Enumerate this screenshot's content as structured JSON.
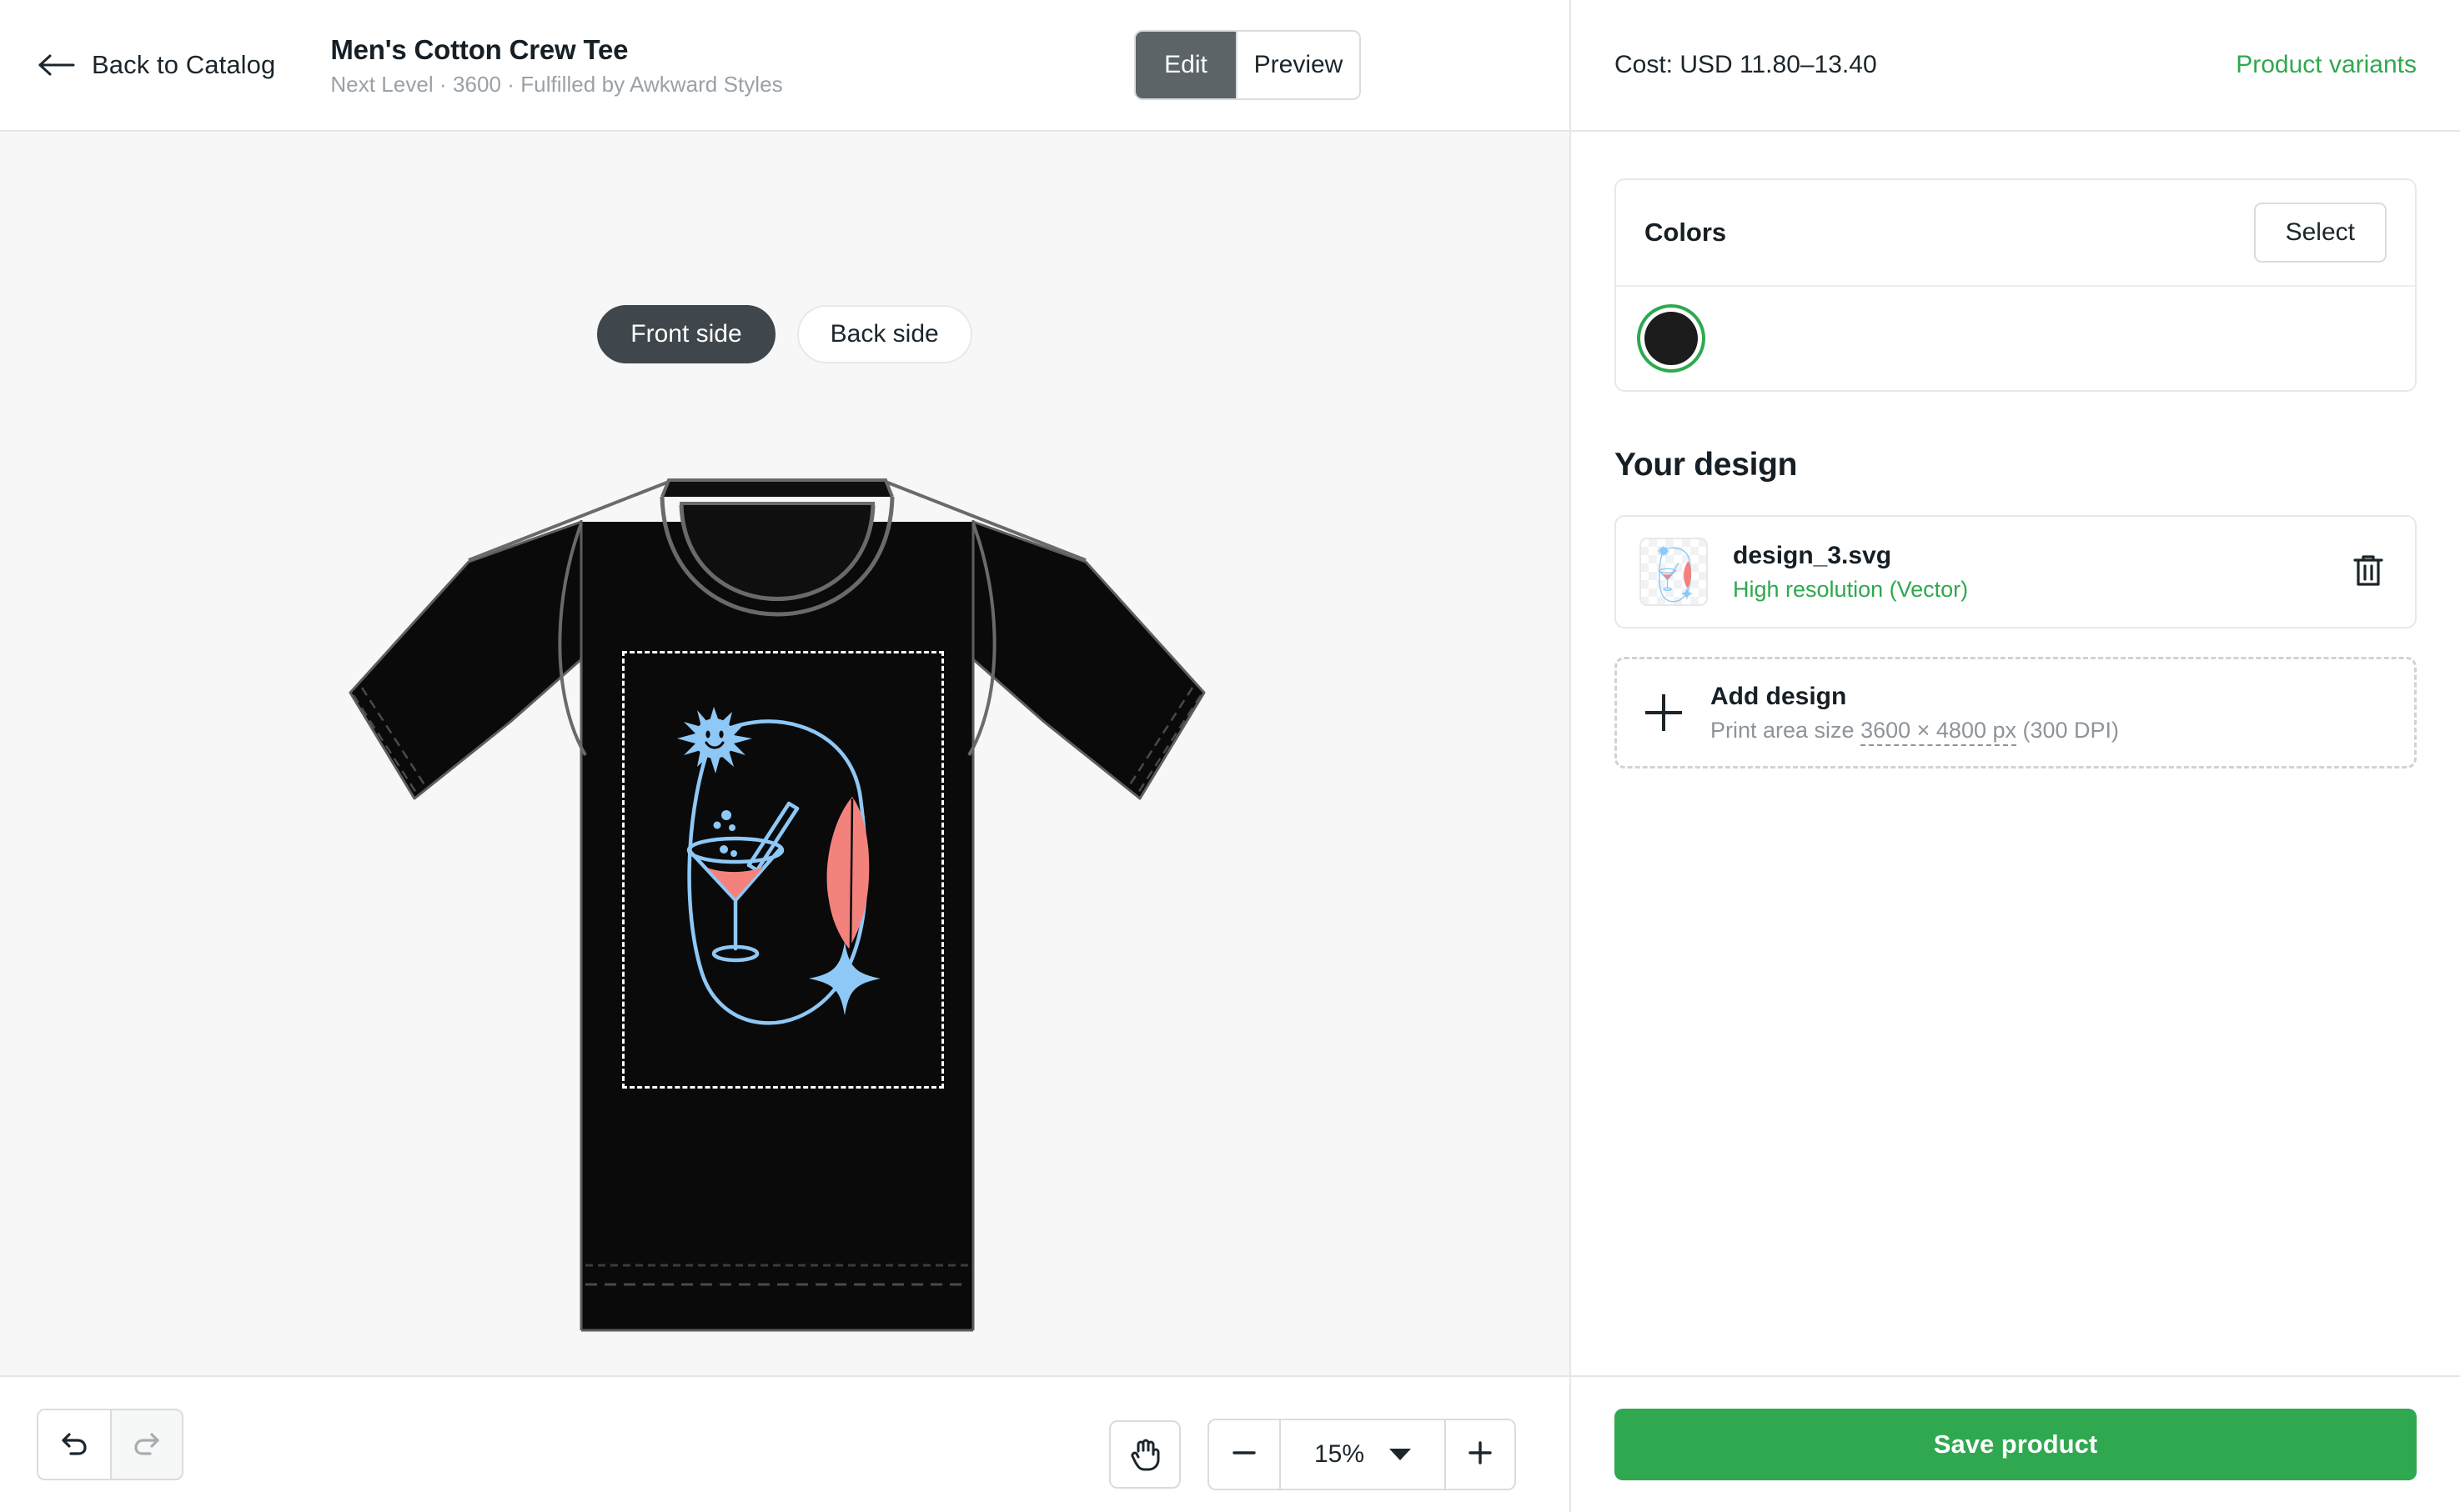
{
  "header": {
    "back_label": "Back to Catalog",
    "back_icon": "arrow-left-icon",
    "product_title": "Men's Cotton Crew Tee",
    "product_subtitle": "Next Level · 3600 · Fulfilled by Awkward Styles",
    "modes": [
      {
        "label": "Edit",
        "active": true
      },
      {
        "label": "Preview",
        "active": false
      }
    ],
    "cost_text": "Cost: USD 11.80–13.40",
    "variants_link": "Product variants"
  },
  "canvas": {
    "sides": [
      {
        "label": "Front side",
        "active": true
      },
      {
        "label": "Back side",
        "active": false
      }
    ],
    "garment_color": "#0a0a0a",
    "background": "#f7f7f7",
    "design_colors": {
      "line": "#8ec8f6",
      "accent": "#f4827c"
    }
  },
  "toolbar": {
    "undo_icon": "undo-icon",
    "redo_icon": "redo-icon",
    "pan_icon": "hand-pan-icon",
    "zoom_out_icon": "minus-icon",
    "zoom_in_icon": "plus-icon",
    "zoom_value": "15%",
    "zoom_caret_icon": "chevron-down-icon"
  },
  "panel": {
    "colors": {
      "title": "Colors",
      "select_label": "Select",
      "swatches": [
        {
          "name": "Black",
          "hex": "#1c1c1c",
          "selected": true
        }
      ]
    },
    "your_design": {
      "title": "Your design",
      "file": {
        "name": "design_3.svg",
        "resolution": "High resolution (Vector)",
        "delete_icon": "trash-icon",
        "thumbnail_icon": "design-thumbnail"
      }
    },
    "add_design": {
      "icon": "plus-icon",
      "title": "Add design",
      "subtitle_prefix": "Print area size ",
      "subtitle_size": "3600 × 4800 px",
      "subtitle_suffix": " (300 DPI)"
    },
    "save_label": "Save product"
  }
}
